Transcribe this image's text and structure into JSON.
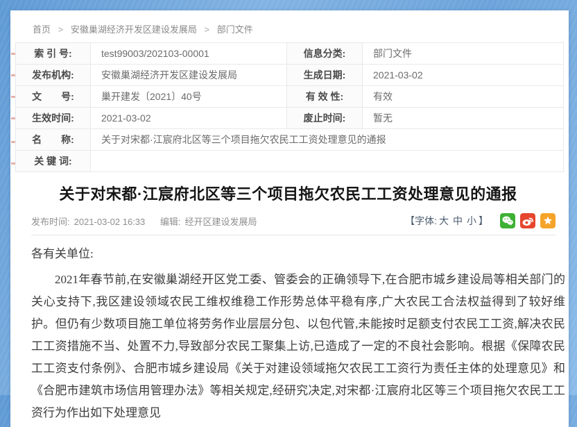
{
  "breadcrumb": {
    "separator": ">",
    "items": [
      "首页",
      "安徽巢湖经济开发区建设发展局",
      "部门文件"
    ]
  },
  "meta_table": {
    "rows": [
      {
        "cells": [
          {
            "label": "索 引 号:",
            "value": "test99003/202103-00001"
          },
          {
            "label": "信息分类:",
            "value": "部门文件"
          }
        ]
      },
      {
        "cells": [
          {
            "label": "发布机构:",
            "value": "安徽巢湖经济开发区建设发展局"
          },
          {
            "label": "生成日期:",
            "value": "2021-03-02"
          }
        ]
      },
      {
        "cells": [
          {
            "label": "文　　号:",
            "value": "巢开建发〔2021〕40号"
          },
          {
            "label": "有 效 性:",
            "value": "有效"
          }
        ]
      },
      {
        "cells": [
          {
            "label": "生效时间:",
            "value": "2021-03-02"
          },
          {
            "label": "废止时间:",
            "value": "暂无"
          }
        ]
      }
    ],
    "full_rows": [
      {
        "label": "名　　称:",
        "value": "关于对宋都·江宸府北区等三个项目拖欠农民工工资处理意见的通报"
      },
      {
        "label": "关 键 词:",
        "value": ""
      }
    ]
  },
  "article": {
    "title": "关于对宋都·江宸府北区等三个项目拖欠农民工工资处理意见的通报",
    "publish_time_label": "发布时间:",
    "publish_time": "2021-03-02 16:33",
    "editor_label": "编辑:",
    "editor": "经开区建设发展局",
    "font_control": {
      "open": "【字体:",
      "sizes": [
        "大",
        "中",
        "小"
      ],
      "close": "】"
    },
    "share": {
      "wechat_color": "#3eb135",
      "weibo_color": "#e6462d",
      "favorite_color": "#f5a42a"
    },
    "paragraphs": [
      "各有关单位:",
      "2021年春节前,在安徽巢湖经开区党工委、管委会的正确领导下,在合肥市城乡建设局等相关部门的关心支持下,我区建设领域农民工维权维稳工作形势总体平稳有序,广大农民工合法权益得到了较好维护。但仍有少数项目施工单位将劳务作业层层分包、以包代管,未能按时足额支付农民工工资,解决农民工工资措施不当、处置不力,导致部分农民工聚集上访,已造成了一定的不良社会影响。根据《保障农民工工资支付条例》、合肥市城乡建设局《关于对建设领域拖欠农民工工资行为责任主体的处理意见》和《合肥市建筑市场信用管理办法》等相关规定,经研究决定,对宋都·江宸府北区等三个项目拖欠农民工工资行为作出如下处理意见"
    ]
  }
}
